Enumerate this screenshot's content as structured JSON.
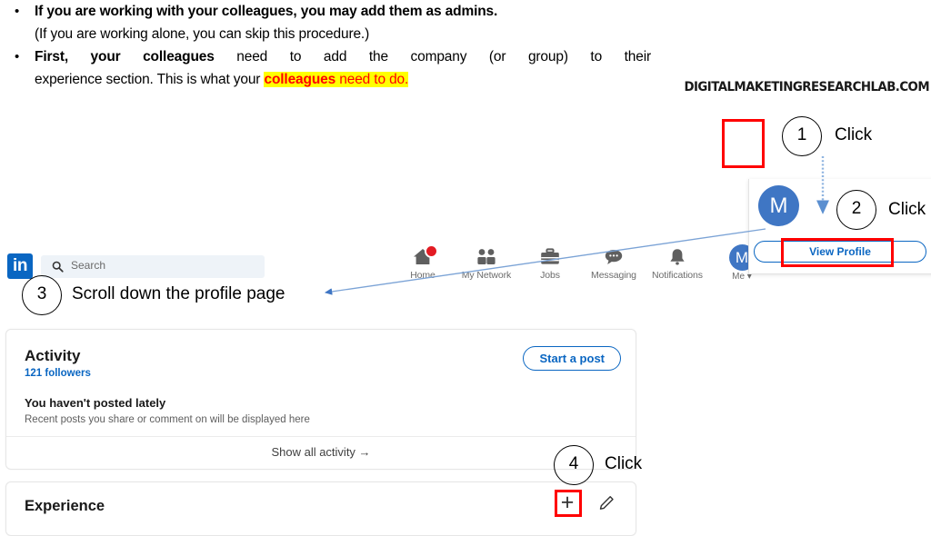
{
  "instructions": {
    "bullet1": {
      "marker": "•",
      "line1": "If you are working with your colleagues, you may add them as admins.",
      "line2": "(If you are working alone, you can skip this procedure.)"
    },
    "bullet2": {
      "marker": "•",
      "line1_bold": "First, your colleagues",
      "line1_rest": " need to add the company (or group) to their",
      "line2_pre": "experience section. This is what your ",
      "line2_hl_bold": "colleagues",
      "line2_hl_rest": " need to do."
    }
  },
  "watermark": "DIGITALMAKETINGRESEARCHLAB.COM",
  "navbar": {
    "logo": "in",
    "search_placeholder": "Search",
    "search_value": "",
    "items": [
      {
        "label": "Home",
        "icon": "home-icon",
        "badge": true
      },
      {
        "label": "My Network",
        "icon": "network-icon",
        "badge": false
      },
      {
        "label": "Jobs",
        "icon": "jobs-icon",
        "badge": false
      },
      {
        "label": "Messaging",
        "icon": "messaging-icon",
        "badge": false
      },
      {
        "label": "Notifications",
        "icon": "bell-icon",
        "badge": false
      }
    ],
    "me": {
      "avatar_initial": "M",
      "label": "Me ▾"
    }
  },
  "dropdown": {
    "avatar_initial": "M",
    "view_profile_label": "View Profile"
  },
  "steps": [
    {
      "number": "1",
      "label": "Click"
    },
    {
      "number": "2",
      "label": "Click"
    },
    {
      "number": "3",
      "label": "Scroll down the profile page"
    },
    {
      "number": "4",
      "label": "Click"
    }
  ],
  "activity_card": {
    "title": "Activity",
    "followers": "121 followers",
    "start_post_label": "Start a post",
    "empty_heading": "You haven't posted lately",
    "empty_sub": "Recent posts you share or comment on will be displayed here",
    "show_all_label": "Show all activity →"
  },
  "experience_card": {
    "title": "Experience",
    "add_label": "+",
    "edit_icon": "pencil-icon"
  },
  "colors": {
    "linkedin_blue": "#0a66c2",
    "avatar_blue": "#3f76c4",
    "highlight_red": "#ff0000",
    "highlight_yellow": "#ffff00",
    "arrow_blue": "#5b8fd0",
    "badge_red": "#e31b23"
  }
}
